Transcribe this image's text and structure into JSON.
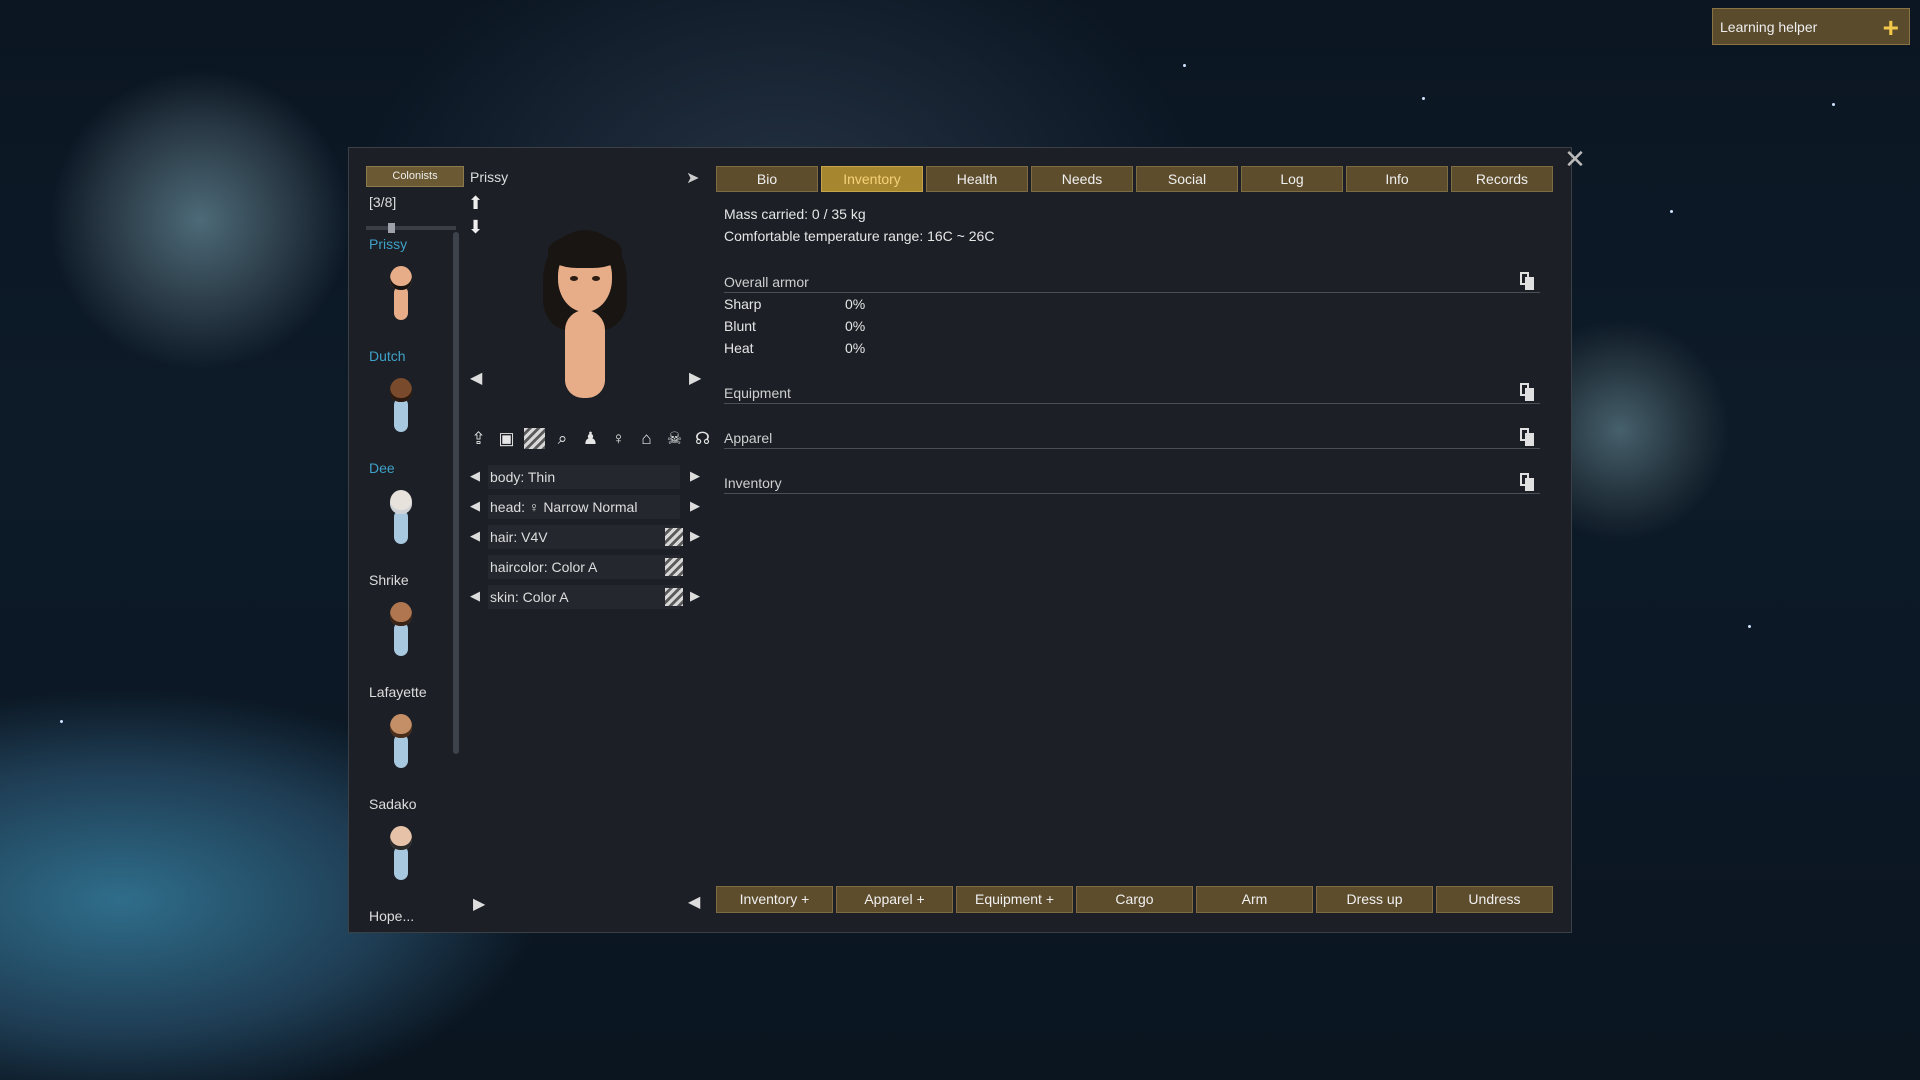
{
  "learning_helper": {
    "label": "Learning helper",
    "plus": "+"
  },
  "colonist_list": {
    "button_label": "Colonists",
    "count": "[3/8]",
    "items": [
      {
        "name": "Prissy",
        "selected": true
      },
      {
        "name": "Dutch",
        "selected": true
      },
      {
        "name": "Dee",
        "selected": true
      },
      {
        "name": "Shrike",
        "selected": false
      },
      {
        "name": "Lafayette",
        "selected": false
      },
      {
        "name": "Sadako",
        "selected": false
      },
      {
        "name": "Hope...",
        "selected": false
      }
    ]
  },
  "pawn": {
    "name": "Prissy",
    "properties": [
      {
        "text": "body: Thin",
        "arrows": true,
        "color": false
      },
      {
        "text": "head: ♀ Narrow Normal",
        "arrows": true,
        "color": false
      },
      {
        "text": "hair: V4V",
        "arrows": true,
        "color": true
      },
      {
        "text": "haircolor: Color A",
        "arrows": false,
        "color": true
      },
      {
        "text": "skin: Color A",
        "arrows": true,
        "color": true
      }
    ]
  },
  "tabs": [
    "Bio",
    "Inventory",
    "Health",
    "Needs",
    "Social",
    "Log",
    "Info",
    "Records"
  ],
  "active_tab": "Inventory",
  "content": {
    "mass": "Mass carried: 0 / 35 kg",
    "temp": "Comfortable temperature range: 16C ~ 26C",
    "overall_armor": "Overall armor",
    "armor": [
      {
        "label": "Sharp",
        "value": "0%"
      },
      {
        "label": "Blunt",
        "value": "0%"
      },
      {
        "label": "Heat",
        "value": "0%"
      }
    ],
    "equipment": "Equipment",
    "apparel": "Apparel",
    "inventory": "Inventory"
  },
  "bottom_buttons": [
    "Inventory +",
    "Apparel +",
    "Equipment +",
    "Cargo",
    "Arm",
    "Dress up",
    "Undress"
  ],
  "icons": [
    "upload-icon",
    "save-icon",
    "color-icon",
    "zoom-icon",
    "bust-icon",
    "female-icon",
    "hanger-icon",
    "skull-icon",
    "headphones-icon"
  ],
  "colors": {
    "accent": "#a6862e",
    "selected_name": "#3fa0c8",
    "button": "#5d4d2d"
  }
}
